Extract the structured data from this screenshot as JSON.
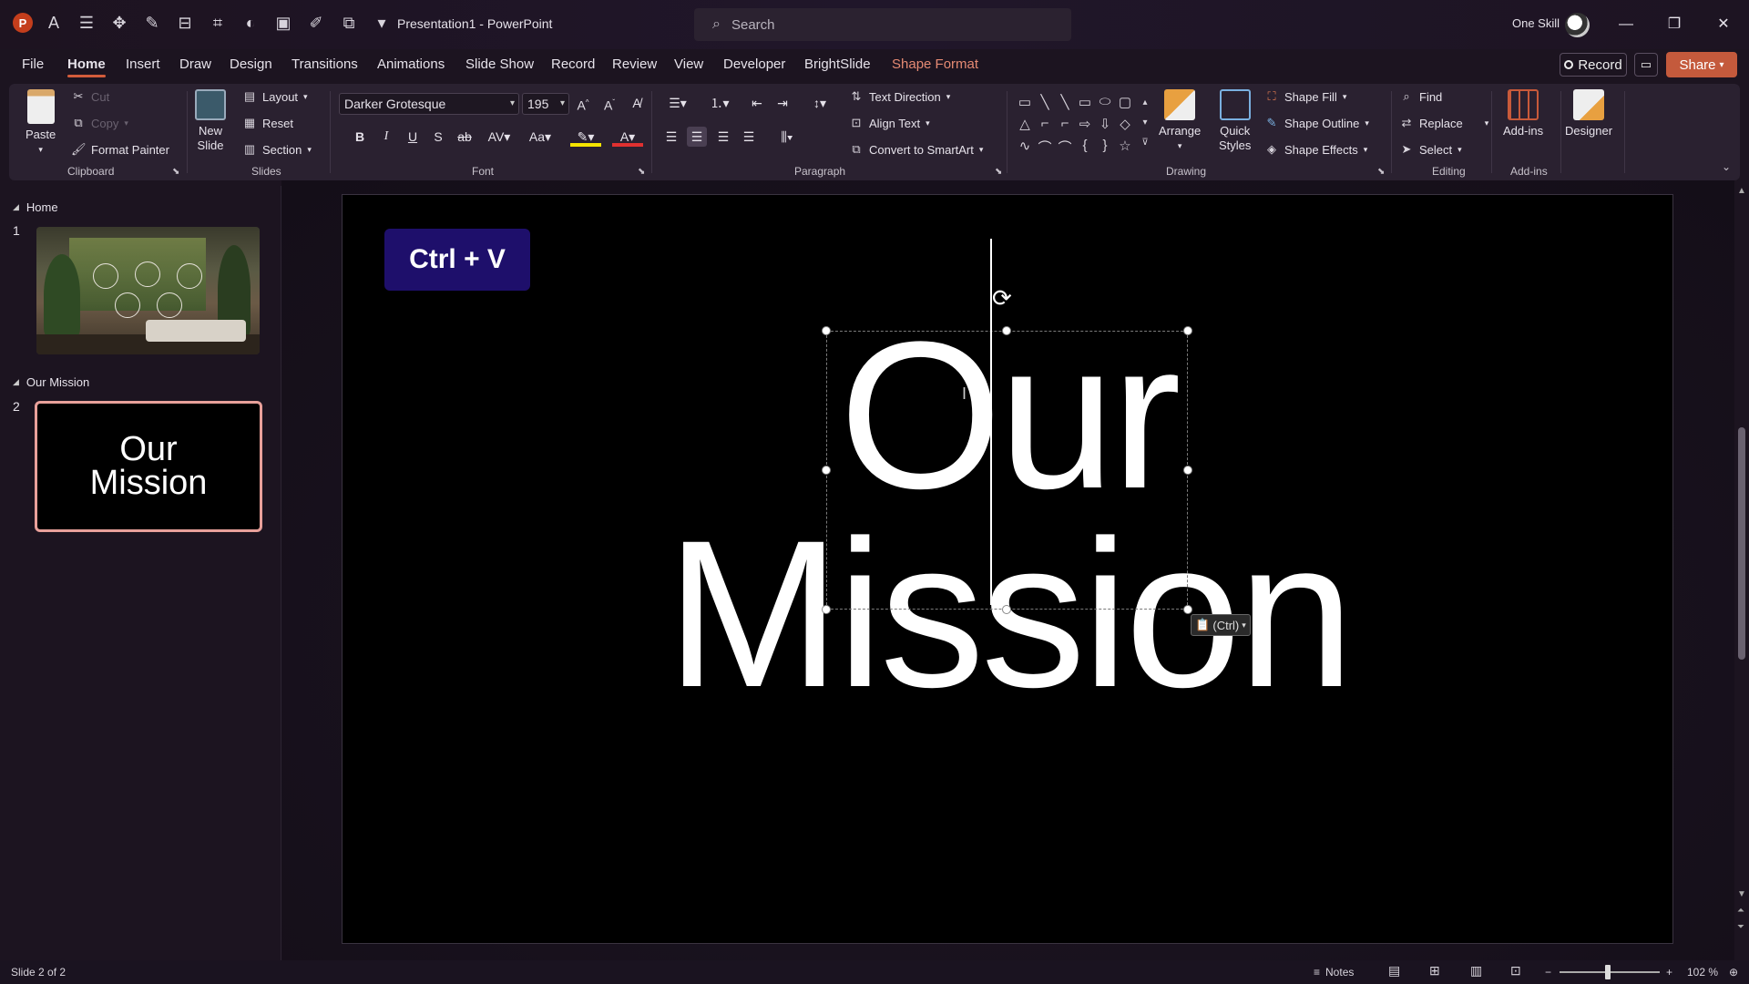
{
  "app": {
    "document_title": "Presentation1  -  PowerPoint",
    "search_placeholder": "Search",
    "account_name": "One Skill",
    "logo_letter": "P"
  },
  "tabs": [
    {
      "label": "File"
    },
    {
      "label": "Home"
    },
    {
      "label": "Insert"
    },
    {
      "label": "Draw"
    },
    {
      "label": "Design"
    },
    {
      "label": "Transitions"
    },
    {
      "label": "Animations"
    },
    {
      "label": "Slide Show"
    },
    {
      "label": "Record"
    },
    {
      "label": "Review"
    },
    {
      "label": "View"
    },
    {
      "label": "Developer"
    },
    {
      "label": "BrightSlide"
    },
    {
      "label": "Shape Format"
    }
  ],
  "top_buttons": {
    "record": "Record",
    "share": "Share"
  },
  "ribbon": {
    "clipboard": {
      "paste": "Paste",
      "cut": "Cut",
      "copy": "Copy",
      "format_painter": "Format Painter",
      "label": "Clipboard"
    },
    "slides": {
      "new_slide_line1": "New",
      "new_slide_line2": "Slide",
      "layout": "Layout",
      "reset": "Reset",
      "section": "Section",
      "label": "Slides"
    },
    "font": {
      "name": "Darker Grotesque",
      "size": "195",
      "label": "Font"
    },
    "paragraph": {
      "text_direction": "Text Direction",
      "align_text": "Align Text",
      "convert_smartart": "Convert to SmartArt",
      "label": "Paragraph"
    },
    "drawing": {
      "arrange": "Arrange",
      "quick_line1": "Quick",
      "quick_line2": "Styles",
      "shape_fill": "Shape Fill",
      "shape_outline": "Shape Outline",
      "shape_effects": "Shape Effects",
      "label": "Drawing"
    },
    "editing": {
      "find": "Find",
      "replace": "Replace",
      "select": "Select",
      "label": "Editing"
    },
    "addins": {
      "addins": "Add-ins",
      "label": "Add-ins"
    },
    "designer": {
      "label": "Designer"
    }
  },
  "slide_pane": {
    "sections": [
      {
        "name": "Home",
        "slide_number": "1"
      },
      {
        "name": "Our Mission",
        "slide_number": "2",
        "thumb_line1": "Our",
        "thumb_line2": "Mission"
      }
    ]
  },
  "slide": {
    "shortcut_badge": "Ctrl + V",
    "title_line1": "Our",
    "title_line2": "Mission",
    "paste_options": "(Ctrl)"
  },
  "status": {
    "slide_info": "Slide 2 of 2",
    "notes": "Notes",
    "zoom": "102 %"
  },
  "colors": {
    "accent": "#d35c3b",
    "share": "#c45a3c",
    "badge": "#1e0f6b",
    "selected_thumb_border": "#e8a09a",
    "contextual_tab": "#e58a73"
  }
}
